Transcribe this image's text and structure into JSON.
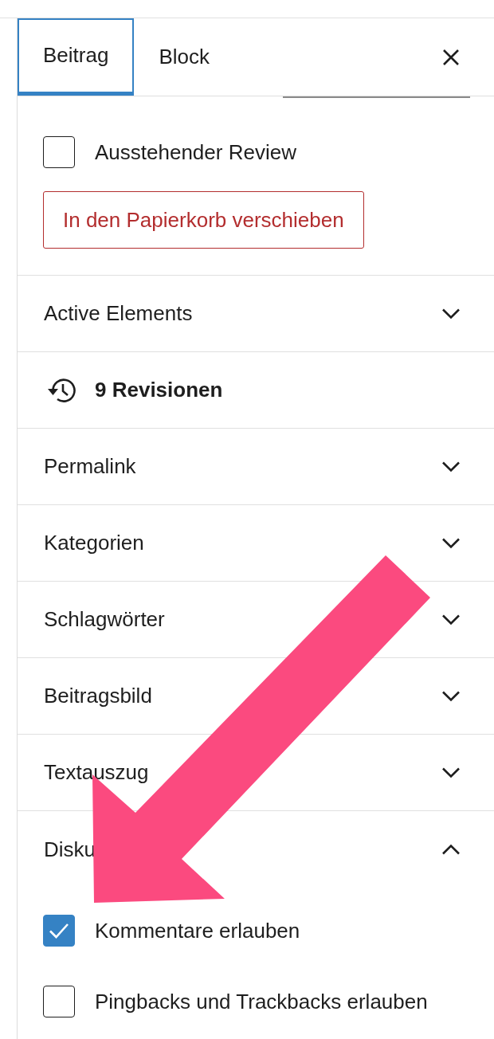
{
  "tabs": [
    {
      "label": "Beitrag",
      "selected": true
    },
    {
      "label": "Block",
      "selected": false
    }
  ],
  "status_section": {
    "options": [
      {
        "label": "Ausstehender Review",
        "checked": false
      }
    ],
    "trash_button": "In den Papierkorb verschieben"
  },
  "panels": [
    {
      "kind": "collapsible",
      "title": "Active Elements",
      "expanded": false
    },
    {
      "kind": "revisions",
      "title": "9 Revisionen"
    },
    {
      "kind": "collapsible",
      "title": "Permalink",
      "expanded": false
    },
    {
      "kind": "collapsible",
      "title": "Kategorien",
      "expanded": false
    },
    {
      "kind": "collapsible",
      "title": "Schlagwörter",
      "expanded": false
    },
    {
      "kind": "collapsible",
      "title": "Beitragsbild",
      "expanded": false
    },
    {
      "kind": "collapsible",
      "title": "Textauszug",
      "expanded": false
    },
    {
      "kind": "collapsible",
      "title": "Disku",
      "expanded": true,
      "options": [
        {
          "label": "Kommentare erlauben",
          "checked": true
        },
        {
          "label": "Pingbacks und Trackbacks erlauben",
          "checked": false
        }
      ]
    }
  ]
}
